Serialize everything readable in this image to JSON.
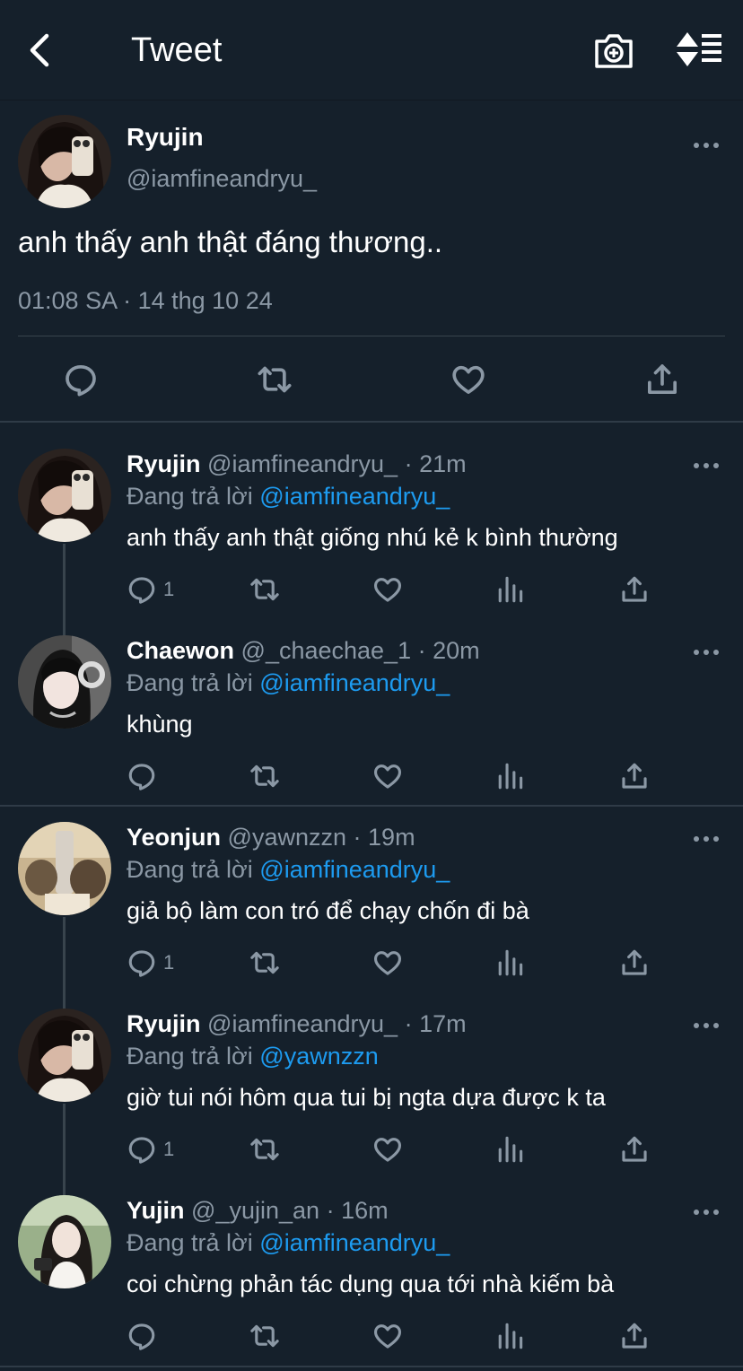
{
  "header": {
    "title": "Tweet",
    "back_icon": "back-arrow-icon",
    "camera_icon": "camera-plus-icon",
    "sort_icon": "sort-icon"
  },
  "main_tweet": {
    "name": "Ryujin",
    "handle": "@iamfineandryu_",
    "text": "anh thấy anh thật đáng thương..",
    "meta": "01:08 SA · 14 thg 10 24"
  },
  "replying_label": "Đang trả lời",
  "replies": [
    {
      "name": "Ryujin",
      "handle": "@iamfineandryu_",
      "time": "21m",
      "reply_to": "@iamfineandryu_",
      "text": "anh thấy anh thật giống nhú kẻ k bình thường",
      "reply_count": "1"
    },
    {
      "name": "Chaewon",
      "handle": "@_chaechae_1",
      "time": "20m",
      "reply_to": "@iamfineandryu_",
      "text": "khùng",
      "reply_count": ""
    },
    {
      "name": "Yeonjun",
      "handle": "@yawnzzn",
      "time": "19m",
      "reply_to": "@iamfineandryu_",
      "text": "giả bộ làm con tró để chạy chốn đi bà",
      "reply_count": "1"
    },
    {
      "name": "Ryujin",
      "handle": "@iamfineandryu_",
      "time": "17m",
      "reply_to": "@yawnzzn",
      "text": "giờ tui nói hôm qua tui bị ngta dựa được k ta",
      "reply_count": "1"
    },
    {
      "name": "Yujin",
      "handle": "@_yujin_an",
      "time": "16m",
      "reply_to": "@iamfineandryu_",
      "text": "coi chừng phản tác dụng qua tới nhà kiếm bà",
      "reply_count": ""
    }
  ],
  "colors": {
    "background": "#15202b",
    "secondary_text": "#8b98a5",
    "mention": "#1d9bf0",
    "divider": "#2f3b47"
  }
}
